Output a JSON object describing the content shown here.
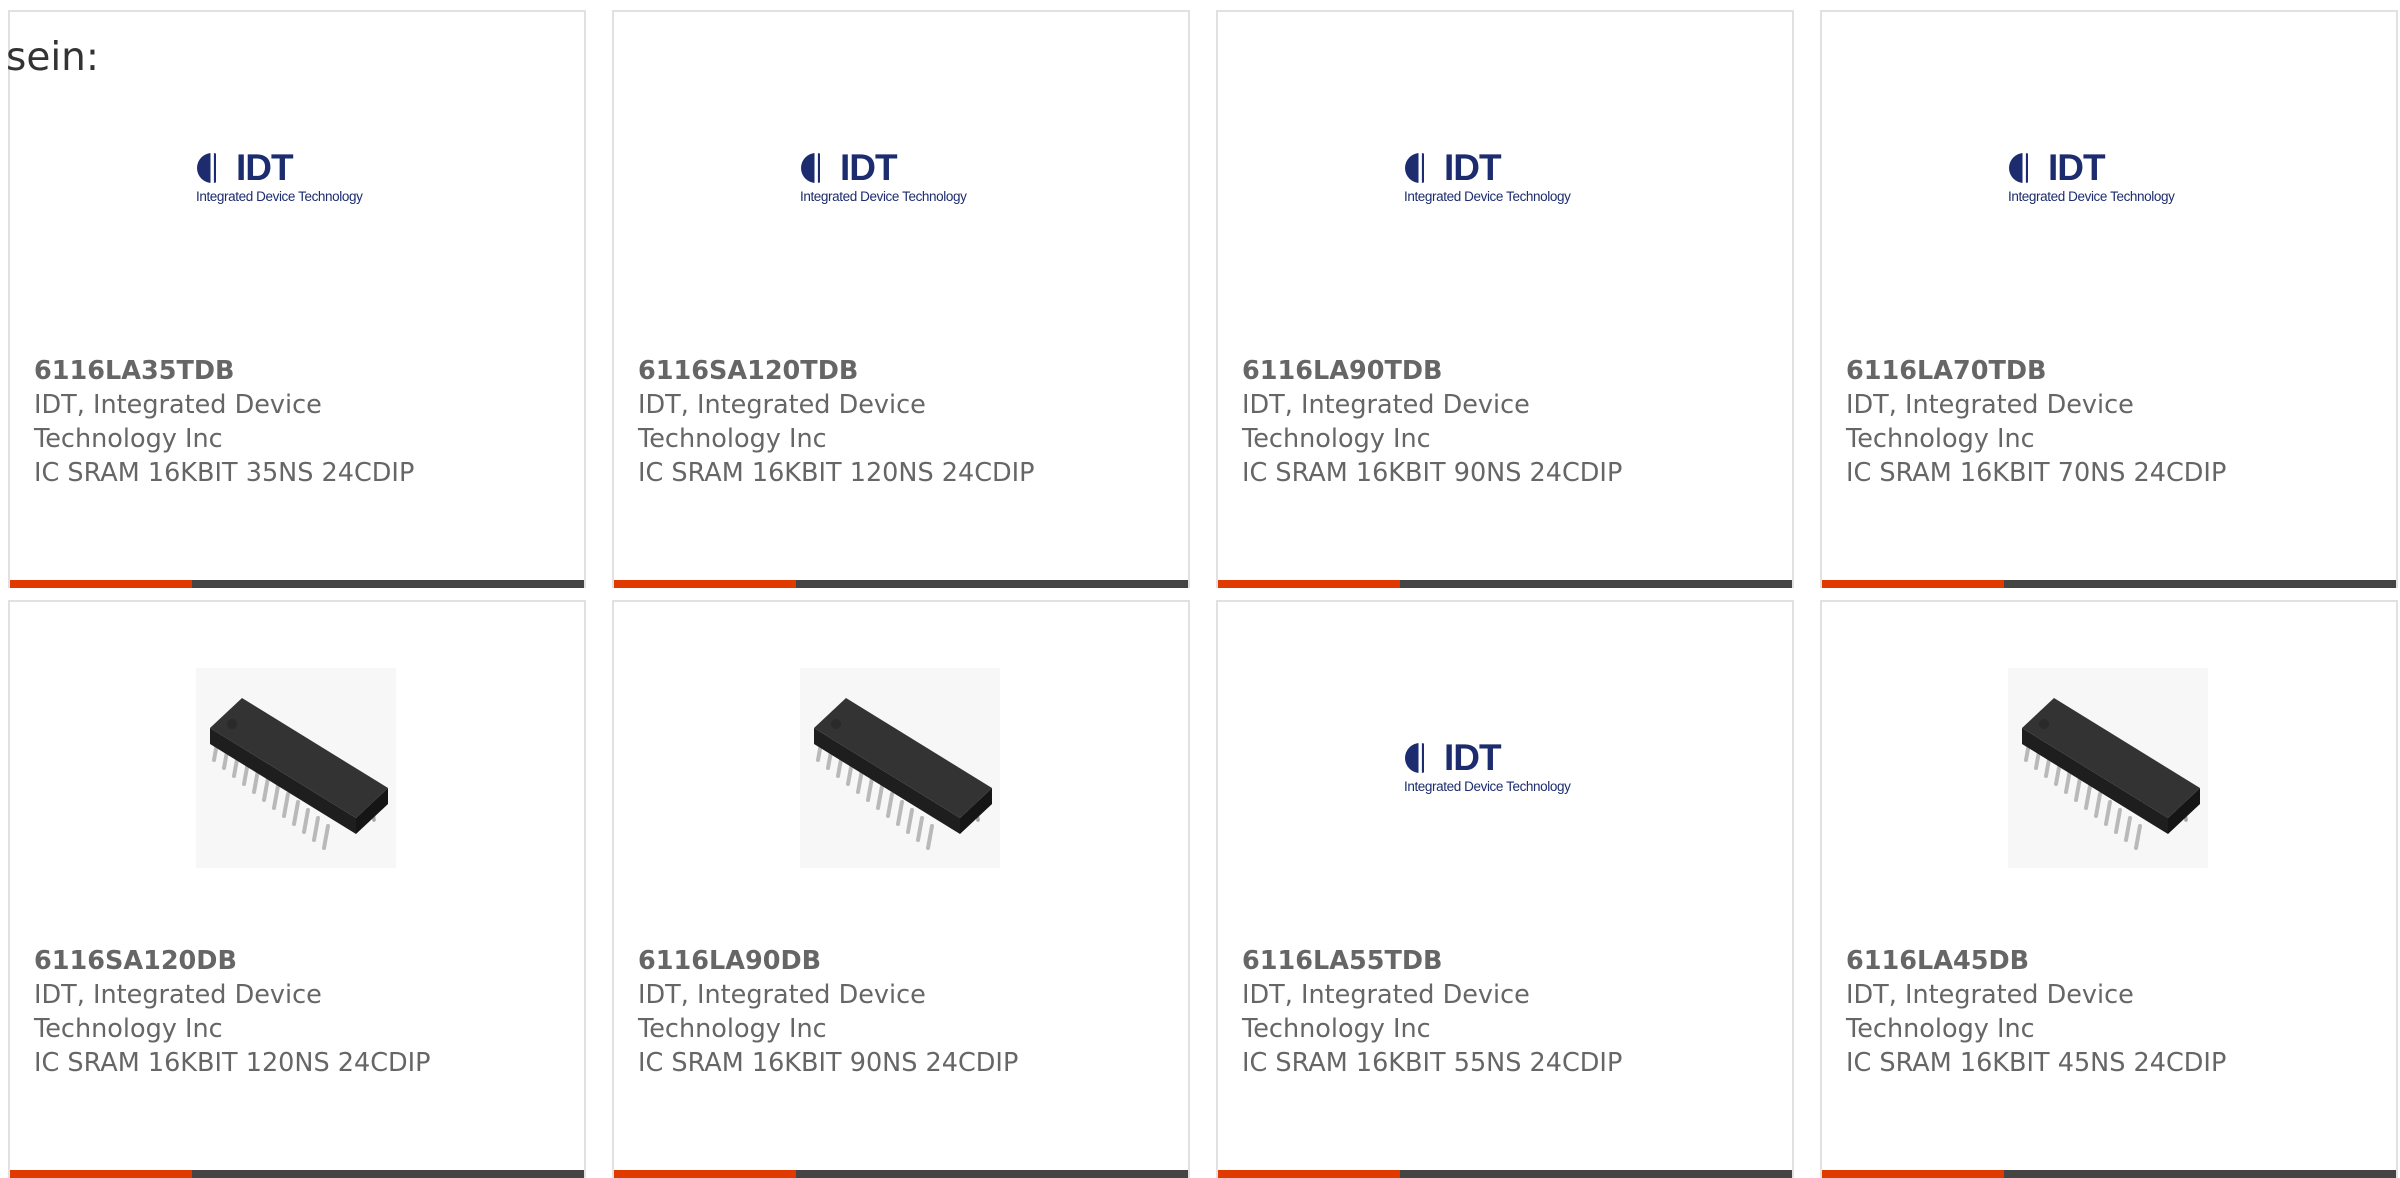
{
  "intro_text": "sein:",
  "logo": {
    "word": "IDT",
    "tagline": "Integrated Device Technology"
  },
  "colors": {
    "accent": "#e03a00",
    "bar": "#444444",
    "logo_blue": "#1c2c6e"
  },
  "products": [
    {
      "part": "6116LA35TDB",
      "manufacturer": "IDT, Integrated Device Technology Inc",
      "description": "IC SRAM 16KBIT 35NS 24CDIP",
      "image": "idt-logo"
    },
    {
      "part": "6116SA120TDB",
      "manufacturer": "IDT, Integrated Device Technology Inc",
      "description": "IC SRAM 16KBIT 120NS 24CDIP",
      "image": "idt-logo"
    },
    {
      "part": "6116LA90TDB",
      "manufacturer": "IDT, Integrated Device Technology Inc",
      "description": "IC SRAM 16KBIT 90NS 24CDIP",
      "image": "idt-logo"
    },
    {
      "part": "6116LA70TDB",
      "manufacturer": "IDT, Integrated Device Technology Inc",
      "description": "IC SRAM 16KBIT 70NS 24CDIP",
      "image": "idt-logo"
    },
    {
      "part": "6116SA120DB",
      "manufacturer": "IDT, Integrated Device Technology Inc",
      "description": "IC SRAM 16KBIT 120NS 24CDIP",
      "image": "dip-chip"
    },
    {
      "part": "6116LA90DB",
      "manufacturer": "IDT, Integrated Device Technology Inc",
      "description": "IC SRAM 16KBIT 90NS 24CDIP",
      "image": "dip-chip"
    },
    {
      "part": "6116LA55TDB",
      "manufacturer": "IDT, Integrated Device Technology Inc",
      "description": "IC SRAM 16KBIT 55NS 24CDIP",
      "image": "idt-logo"
    },
    {
      "part": "6116LA45DB",
      "manufacturer": "IDT, Integrated Device Technology Inc",
      "description": "IC SRAM 16KBIT 45NS 24CDIP",
      "image": "dip-chip"
    }
  ]
}
